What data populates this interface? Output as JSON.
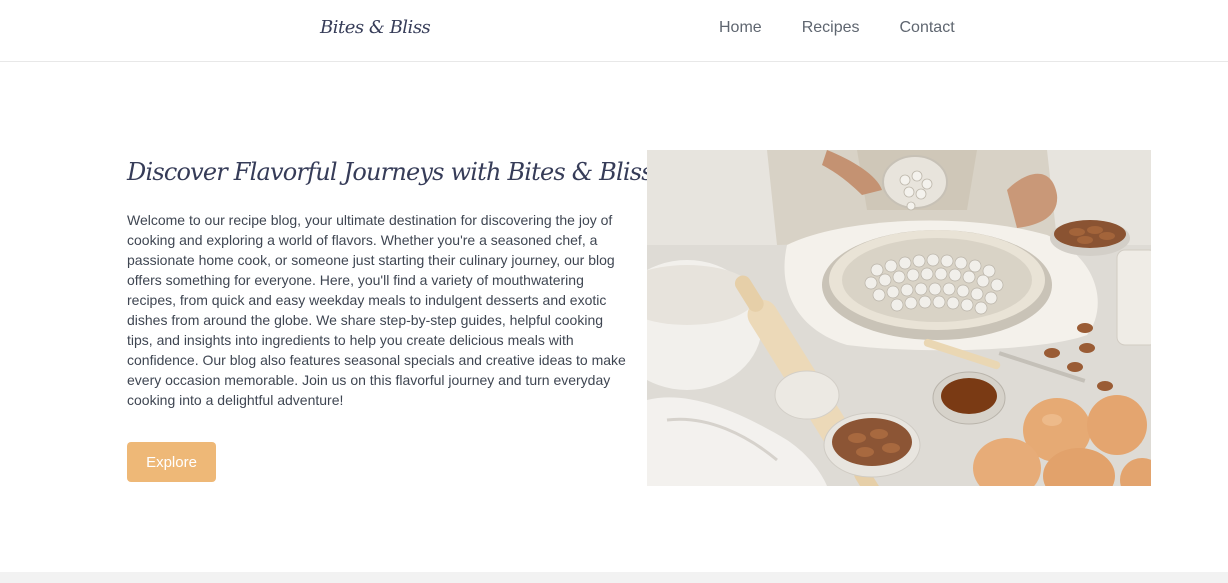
{
  "header": {
    "logo": "Bites & Bliss",
    "nav": [
      {
        "label": "Home"
      },
      {
        "label": "Recipes"
      },
      {
        "label": "Contact"
      }
    ]
  },
  "hero": {
    "title": "Discover Flavorful Journeys with Bites & Bliss",
    "description": "Welcome to our recipe blog, your ultimate destination for discovering the joy of cooking and exploring a world of flavors. Whether you're a seasoned chef, a passionate home cook, or someone just starting their culinary journey, our blog offers something for everyone. Here, you'll find a variety of mouthwatering recipes, from quick and easy weekday meals to indulgent desserts and exotic dishes from around the globe. We share step-by-step guides, helpful cooking tips, and insights into ingredients to help you create delicious meals with confidence. Our blog also features seasonal specials and creative ideas to make every occasion memorable. Join us on this flavorful journey and turn everyday cooking into a delightful adventure!",
    "button_label": "Explore"
  },
  "colors": {
    "accent": "#eeb877",
    "heading": "#363c58",
    "nav_text": "#5f6670",
    "body_text": "#3f4652"
  },
  "image": {
    "icon": "baking-photo"
  }
}
